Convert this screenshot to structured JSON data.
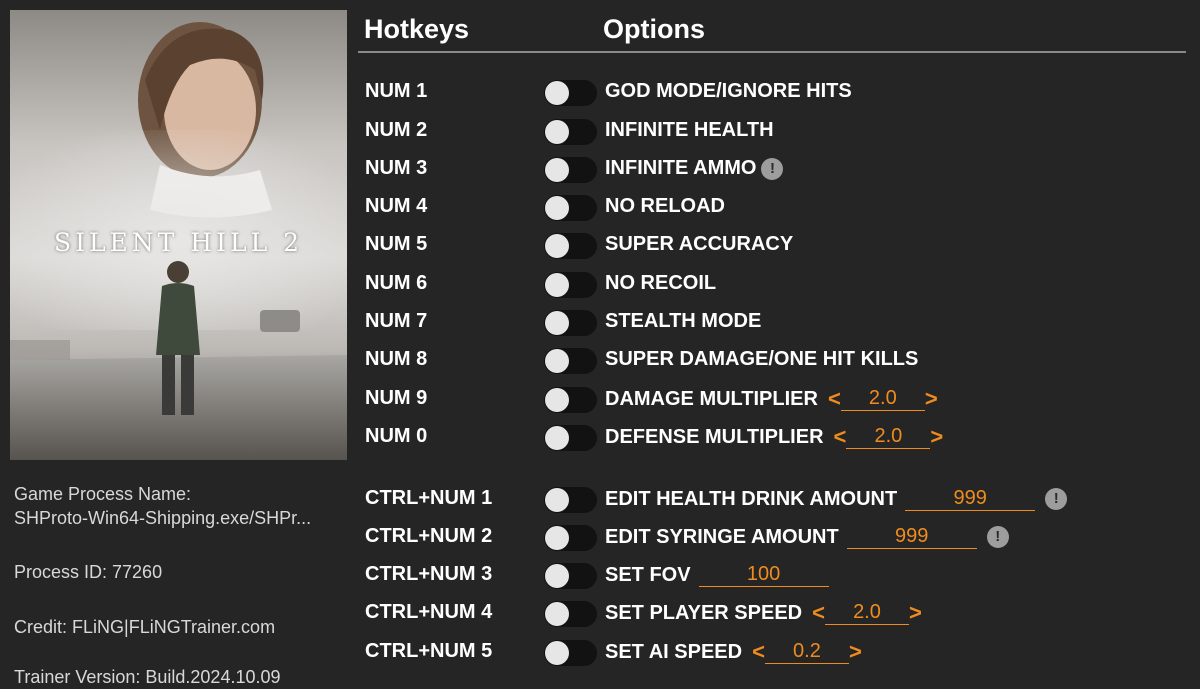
{
  "cover": {
    "title": "SILENT HILL 2"
  },
  "info": {
    "process_label": "Game Process Name:",
    "process_name": "SHProto-Win64-Shipping.exe/SHPr...",
    "process_id": "Process ID: 77260",
    "credit": "Credit: FLiNG|FLiNGTrainer.com",
    "version": "Trainer Version: Build.2024.10.09"
  },
  "header": {
    "hotkeys": "Hotkeys",
    "options": "Options"
  },
  "rows": [
    {
      "hotkey": "NUM 1",
      "label": "GOD MODE/IGNORE HITS"
    },
    {
      "hotkey": "NUM 2",
      "label": "INFINITE HEALTH"
    },
    {
      "hotkey": "NUM 3",
      "label": "INFINITE AMMO",
      "warning": "!"
    },
    {
      "hotkey": "NUM 4",
      "label": "NO RELOAD"
    },
    {
      "hotkey": "NUM 5",
      "label": "SUPER ACCURACY"
    },
    {
      "hotkey": "NUM 6",
      "label": "NO RECOIL"
    },
    {
      "hotkey": "NUM 7",
      "label": "STEALTH MODE"
    },
    {
      "hotkey": "NUM 8",
      "label": "SUPER DAMAGE/ONE HIT KILLS"
    },
    {
      "hotkey": "NUM 9",
      "label": "DAMAGE MULTIPLIER",
      "value": "2.0",
      "arrow_left": "<",
      "arrow_right": ">"
    },
    {
      "hotkey": "NUM 0",
      "label": "DEFENSE MULTIPLIER",
      "value": "2.0",
      "arrow_left": "<",
      "arrow_right": ">"
    },
    {
      "hotkey": "CTRL+NUM 1",
      "label": "EDIT HEALTH DRINK AMOUNT",
      "value": "999",
      "warning": "!"
    },
    {
      "hotkey": "CTRL+NUM 2",
      "label": "EDIT SYRINGE AMOUNT",
      "value": "999",
      "warning": "!"
    },
    {
      "hotkey": "CTRL+NUM 3",
      "label": "SET FOV",
      "value": "100"
    },
    {
      "hotkey": "CTRL+NUM 4",
      "label": "SET PLAYER SPEED",
      "value": "2.0",
      "arrow_left": "<",
      "arrow_right": ">"
    },
    {
      "hotkey": "CTRL+NUM 5",
      "label": "SET AI SPEED",
      "value": "0.2",
      "arrow_left": "<",
      "arrow_right": ">"
    }
  ],
  "colors": {
    "accent": "#f08c1e",
    "background": "#252525",
    "toggle_track": "#121212",
    "toggle_knob": "#e6e6e6"
  }
}
